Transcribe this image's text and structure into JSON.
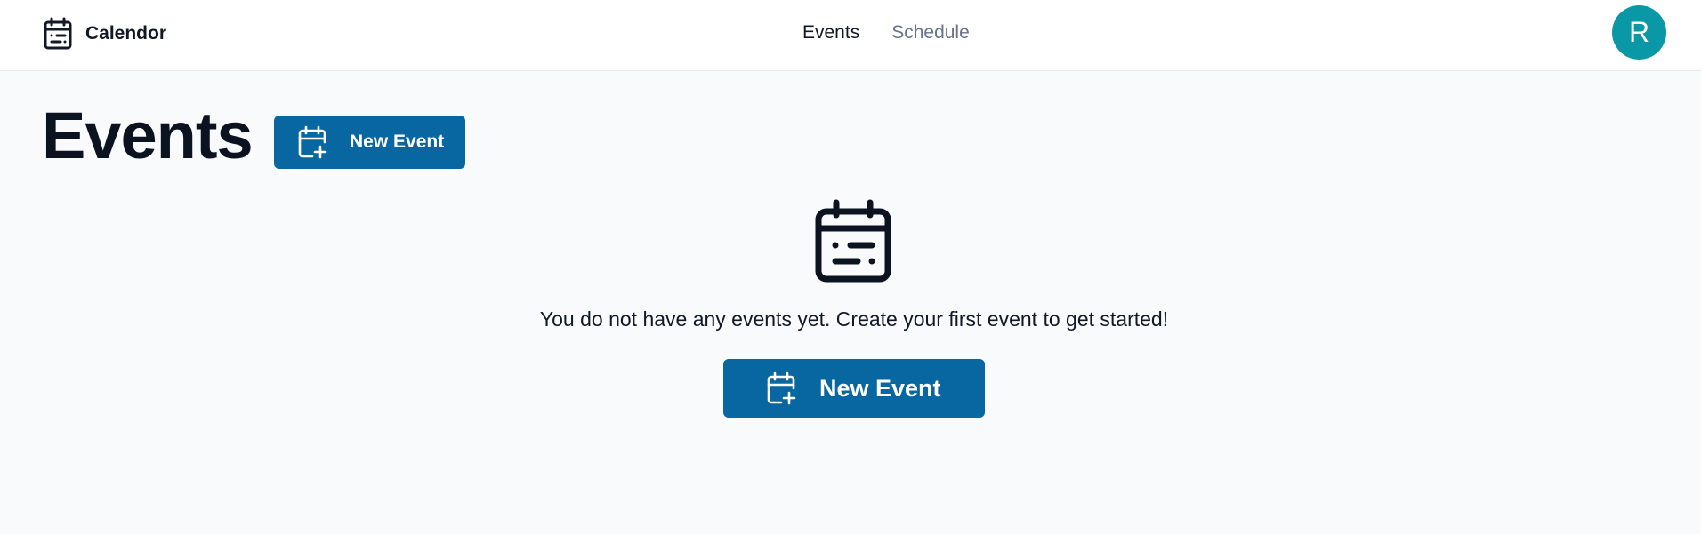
{
  "header": {
    "brand_name": "Calendor",
    "brand_icon": "calendar-icon",
    "nav": [
      {
        "label": "Events",
        "active": true
      },
      {
        "label": "Schedule",
        "active": false
      }
    ],
    "avatar_initial": "R",
    "avatar_color": "#0a98a6"
  },
  "main": {
    "title": "Events",
    "new_event_label": "New Event",
    "new_event_icon": "calendar-plus-icon",
    "empty_state": {
      "icon": "calendar-icon",
      "message": "You do not have any events yet. Create your first event to get started!",
      "button_label": "New Event"
    }
  },
  "colors": {
    "primary": "#0866a0",
    "background": "#f9fafb",
    "nav_inactive": "#64748b"
  }
}
